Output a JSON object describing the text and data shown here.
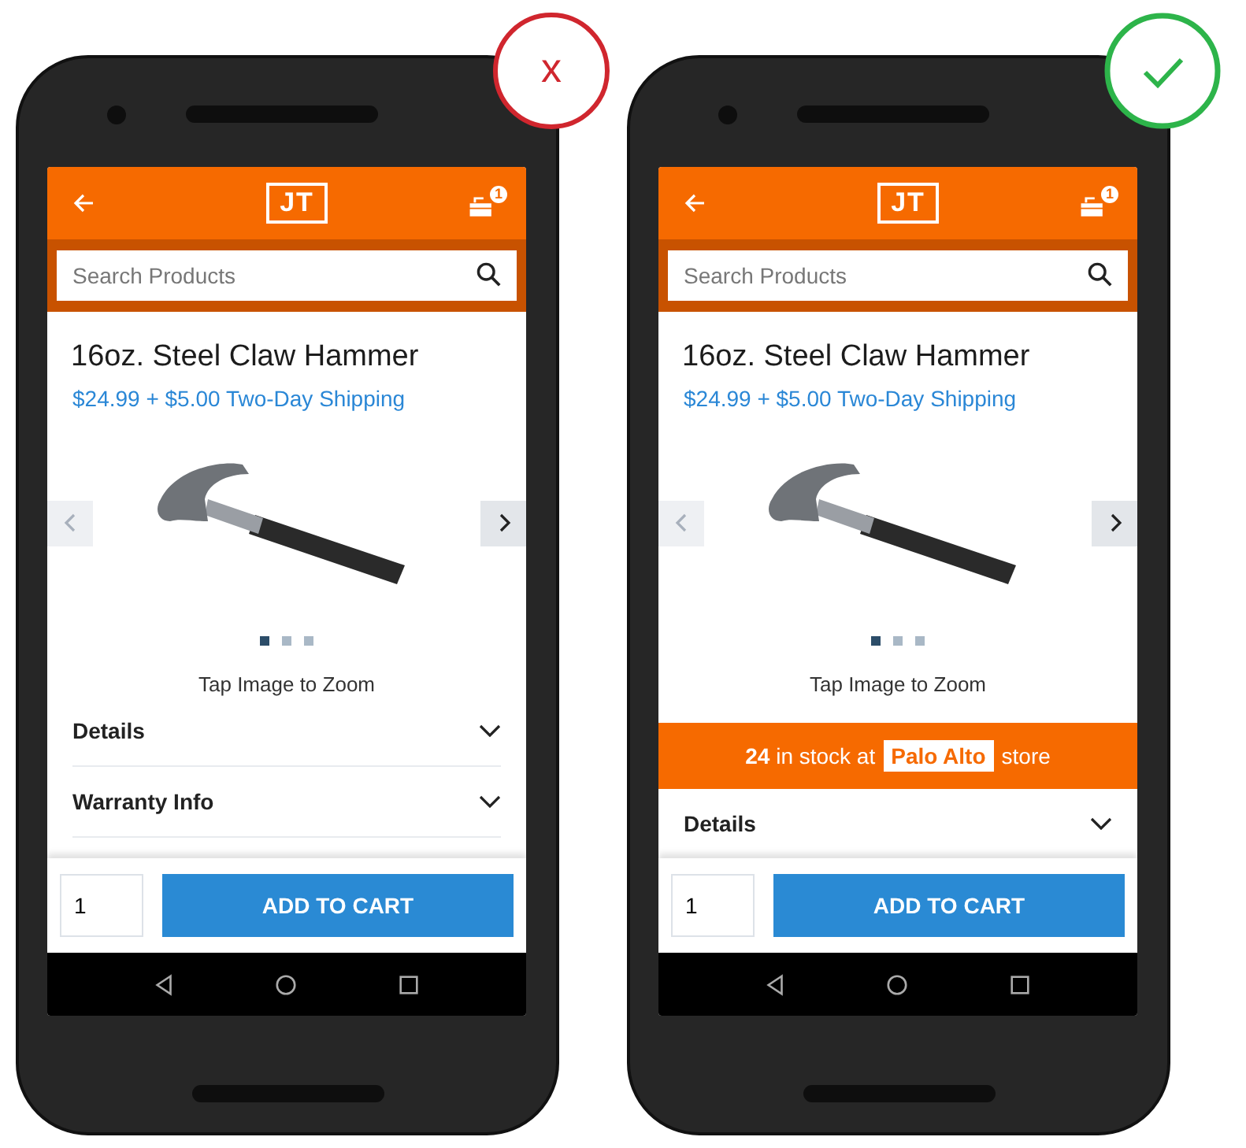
{
  "phones": [
    {
      "verdict": {
        "kind": "bad",
        "mark": "x"
      },
      "header": {
        "logo": "JT",
        "cart_count": "1"
      },
      "search": {
        "placeholder": "Search Products"
      },
      "product": {
        "title": "16oz. Steel Claw Hammer",
        "price": "$24.99 + $5.00 Two-Day Shipping"
      },
      "carousel": {
        "dots": [
          {
            "selected": true
          },
          {
            "selected": false
          },
          {
            "selected": false
          }
        ]
      },
      "zoom_hint": "Tap Image to Zoom",
      "sections": [
        "Details",
        "Warranty Info"
      ],
      "quantity": "1",
      "add_button": "ADD TO CART"
    },
    {
      "verdict": {
        "kind": "good"
      },
      "header": {
        "logo": "JT",
        "cart_count": "1"
      },
      "search": {
        "placeholder": "Search Products"
      },
      "product": {
        "title": "16oz. Steel Claw Hammer",
        "price": "$24.99 + $5.00 Two-Day Shipping"
      },
      "carousel": {
        "dots": [
          {
            "selected": true
          },
          {
            "selected": false
          },
          {
            "selected": false
          }
        ]
      },
      "zoom_hint": "Tap Image to Zoom",
      "stock_banner": {
        "count": "24",
        "text": "in stock at",
        "store": "Palo Alto",
        "suffix": "store"
      },
      "sections": [
        "Details"
      ],
      "quantity": "1",
      "add_button": "ADD TO CART"
    }
  ]
}
